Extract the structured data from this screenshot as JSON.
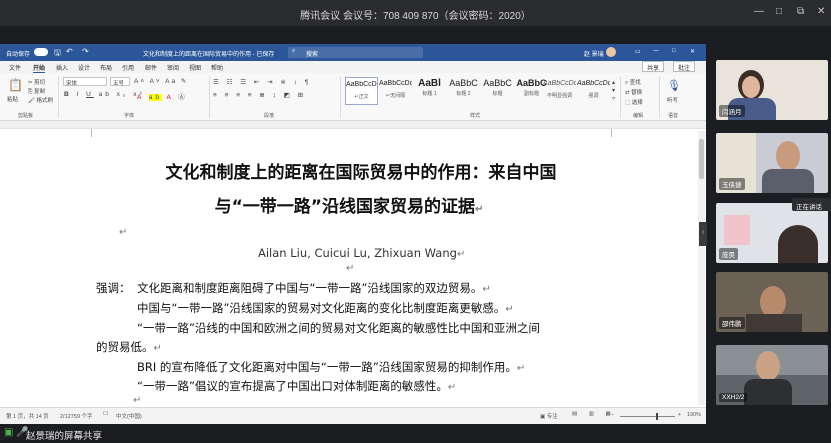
{
  "meeting": {
    "title": "腾讯会议 会议号：708 409 870（会议密码：2020）",
    "controls": [
      "—",
      "□",
      "⧉",
      "✕"
    ],
    "speaking_label": "正在讲话",
    "share_banner": "赵景瑞的屏幕共享"
  },
  "word": {
    "autosave": "自动保存",
    "doc_title": "文化和制度上的距离在国际贸易中的作用 - 已保存",
    "search_placeholder": "搜索",
    "user": "赵 景瑞",
    "tabs": [
      "文件",
      "开始",
      "插入",
      "设计",
      "布局",
      "引用",
      "邮件",
      "审阅",
      "视图",
      "帮助"
    ],
    "share_label": "共享",
    "comment_label": "批注",
    "clipboard": {
      "paste": "粘贴",
      "cut": "剪切",
      "copy": "复制",
      "format_painter": "格式刷",
      "label": "剪贴板"
    },
    "font": {
      "name": "宋体",
      "size": "五号",
      "label": "字体"
    },
    "paragraph_label": "段落",
    "styles": [
      {
        "preview": "AaBbCcDc",
        "name": "↵正文"
      },
      {
        "preview": "AaBbCcDc",
        "name": "↵无间隔"
      },
      {
        "preview": "AaBl",
        "name": "标题 1"
      },
      {
        "preview": "AaBbC",
        "name": "标题 2"
      },
      {
        "preview": "AaBbC",
        "name": "标题"
      },
      {
        "preview": "AaBbC",
        "name": "副标题"
      },
      {
        "preview": "AaBbCcDc",
        "name": "不明显强调"
      },
      {
        "preview": "AaBbCcDc",
        "name": "强调"
      }
    ],
    "styles_label": "样式",
    "editing": {
      "find": "查找",
      "replace": "替换",
      "select": "选择",
      "label": "编辑"
    },
    "voice": {
      "dictate": "听写",
      "label": "语音"
    },
    "status": {
      "page": "第 1 页，共 14 页",
      "words": "2/12759 个字",
      "lang": "中文(中国)",
      "focus": "专注",
      "zoom": "190%"
    }
  },
  "document": {
    "title_line1": "文化和制度上的距离在国际贸易中的作用：来自中国",
    "title_line2": "与“一带一路”沿线国家贸易的证据",
    "authors": "Ailan Liu, Cuicui Lu, Zhixuan Wang",
    "highlights_label": "强调：",
    "highlights": [
      "文化距离和制度距离阻碍了中国与“一带一路”沿线国家的双边贸易。",
      "中国与“一带一路”沿线国家的贸易对文化距离的变化比制度距离更敏感。",
      "“一带一路”沿线的中国和欧洲之间的贸易对文化距离的敏感性比中国和亚洲之间",
      "的贸易低。",
      "BRI 的宣布降低了文化距离对中国与“一带一路”沿线国家贸易的抑制作用。",
      "“一带一路”倡议的宣布提高了中国出口对体制距离的敏感性。"
    ],
    "para_mark": "↵"
  },
  "participants": [
    {
      "name": "闫涵月",
      "bg": "#e9e4da"
    },
    {
      "name": "玉侠捷",
      "bg": "#c9ccd4"
    },
    {
      "name": "庞昊",
      "bg": "#dfe3e8"
    },
    {
      "name": "邵伟鹏",
      "bg": "#6b6155"
    },
    {
      "name": "XXH2/2",
      "bg": "#8a8f94"
    }
  ]
}
